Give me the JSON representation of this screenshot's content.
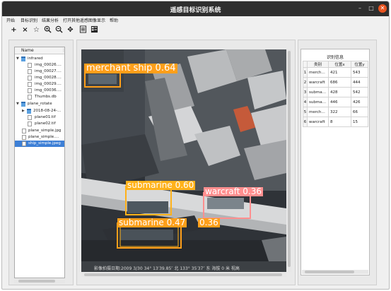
{
  "window": {
    "title": "遥感目标识别系统"
  },
  "menubar": {
    "items": [
      "开始",
      "目标识别",
      "结果分析",
      "打开其他遥感图像",
      "显示",
      "帮助"
    ]
  },
  "toolbar": {
    "icons": [
      "plus-icon",
      "close-icon",
      "star-icon",
      "zoom-in-icon",
      "zoom-out-icon",
      "move-icon",
      "list-icon",
      "detail-icon"
    ]
  },
  "filetree": {
    "header": "Name",
    "items": [
      {
        "label": "infrared",
        "type": "folder"
      },
      {
        "label": "img_00026.…",
        "type": "file"
      },
      {
        "label": "img_00027.…",
        "type": "file"
      },
      {
        "label": "img_00028.…",
        "type": "file"
      },
      {
        "label": "img_00029.…",
        "type": "file"
      },
      {
        "label": "img_00036.…",
        "type": "file"
      },
      {
        "label": "Thumbs.db",
        "type": "file"
      },
      {
        "label": "plane_rotate",
        "type": "folder"
      },
      {
        "label": "2018-08-24-…",
        "type": "folder"
      },
      {
        "label": "plane01.tif",
        "type": "file"
      },
      {
        "label": "plane02.tif",
        "type": "file"
      },
      {
        "label": "plane_simple.jpg",
        "type": "file"
      },
      {
        "label": "plane_simple.…",
        "type": "file"
      },
      {
        "label": "ship_simple.jpeg",
        "type": "file",
        "selected": true
      }
    ]
  },
  "detections": [
    {
      "label": "merchant ship 0.64",
      "color": "#ff9f1a"
    },
    {
      "label": "submarine 0.60",
      "color": "#ffb21a"
    },
    {
      "label": "warcraft 0.36",
      "color": "#ff8f8f"
    },
    {
      "label": "submarine 0.47",
      "color": "#ff9f1a"
    },
    {
      "label": "0.36",
      "color": "#ff9f1a"
    }
  ],
  "image_caption": "影像拍摄日期:2009 3/30  34° 13′39.85″ 北 133° 35′37″ 东 海拔   0 米 视高",
  "info": {
    "title": "识别信息",
    "columns": [
      "类别",
      "位置x",
      "位置y"
    ],
    "rows": [
      {
        "n": "1",
        "cls": "merch…",
        "x": "421",
        "y": "543"
      },
      {
        "n": "2",
        "cls": "warcraft",
        "x": "686",
        "y": "444"
      },
      {
        "n": "3",
        "cls": "subma…",
        "x": "428",
        "y": "542"
      },
      {
        "n": "4",
        "cls": "subma…",
        "x": "446",
        "y": "426"
      },
      {
        "n": "5",
        "cls": "merch…",
        "x": "322",
        "y": "66"
      },
      {
        "n": "6",
        "cls": "warcraft",
        "x": "8",
        "y": "15"
      }
    ]
  }
}
